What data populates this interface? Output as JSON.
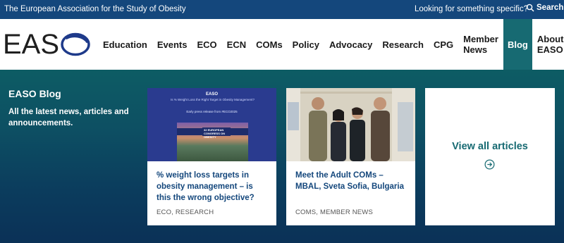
{
  "topbar": {
    "org_name": "The European Association for the Study of Obesity",
    "looking_text": "Looking for something specific?",
    "search_label": "Search"
  },
  "logo": {
    "letters": "EAS",
    "final_letter": "O"
  },
  "nav": {
    "items": [
      {
        "label": "Education"
      },
      {
        "label": "Events"
      },
      {
        "label": "ECO"
      },
      {
        "label": "ECN"
      },
      {
        "label": "COMs"
      },
      {
        "label": "Policy"
      },
      {
        "label": "Advocacy"
      },
      {
        "label": "Research"
      },
      {
        "label": "CPG"
      },
      {
        "label": "Member News"
      },
      {
        "label": "Blog",
        "active": true
      },
      {
        "label": "About EASO"
      }
    ]
  },
  "blog": {
    "title": "EASO Blog",
    "subtitle": "All the latest news, articles and announcements.",
    "cards": [
      {
        "title": "% weight loss targets in obesity management – is this the wrong objective?",
        "tags": "ECO, RESEARCH",
        "thumb": {
          "brand": "EASO",
          "question": "Is % Weight Loss the Right Target in Obesity Management?",
          "release": "Early press release from #ECO2025",
          "badge_number": "32",
          "badge_text": "EUROPEAN CONGRESS ON OBESITY"
        }
      },
      {
        "title": "Meet the Adult COMs – MBAL, Sveta Sofia, Bulgaria",
        "tags": "COMS, MEMBER NEWS"
      }
    ],
    "view_all_label": "View all articles"
  },
  "colors": {
    "topbar_bg": "#14477c",
    "nav_active_bg": "#176a72",
    "card_title": "#14477c",
    "view_all": "#176a72",
    "logo_o": "#1e3a8a"
  },
  "icons": [
    "search-icon",
    "arrow-circle-right-icon"
  ]
}
